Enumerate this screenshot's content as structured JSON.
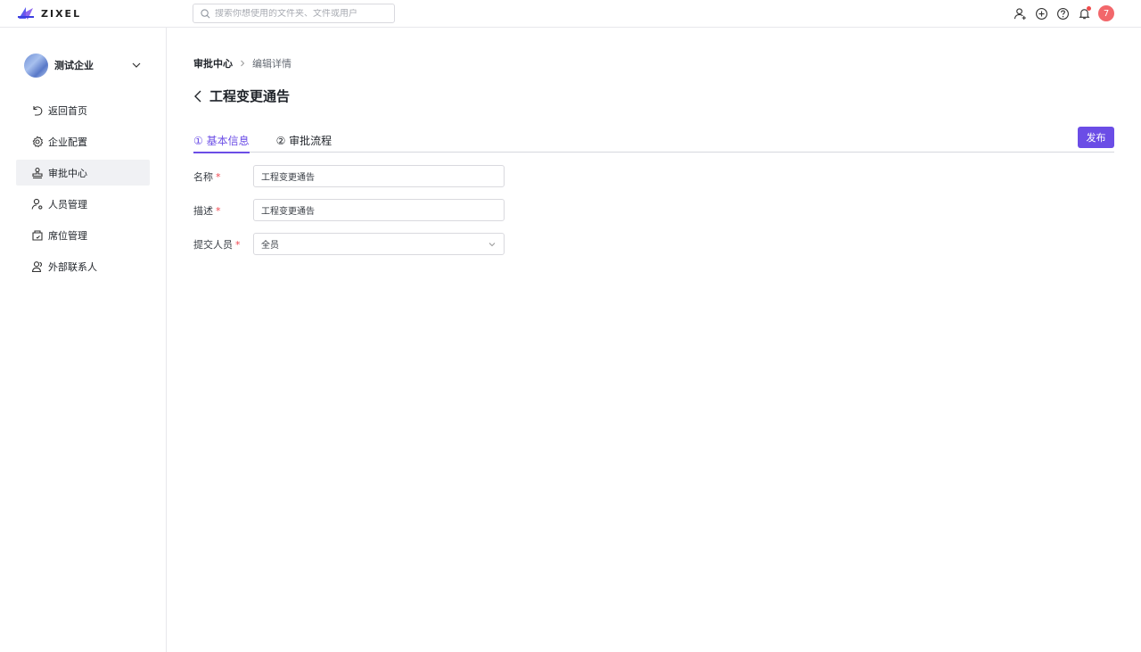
{
  "app": {
    "logo_text": "ZIXEL",
    "search_placeholder": "搜索你想使用的文件夹、文件或用户",
    "user_avatar_text": "7"
  },
  "sidebar": {
    "org_name": "测试企业",
    "items": [
      {
        "label": "返回首页",
        "icon": "return-icon"
      },
      {
        "label": "企业配置",
        "icon": "gear-icon"
      },
      {
        "label": "审批中心",
        "icon": "stamp-icon",
        "active": true
      },
      {
        "label": "人员管理",
        "icon": "user-settings-icon"
      },
      {
        "label": "席位管理",
        "icon": "seat-icon"
      },
      {
        "label": "外部联系人",
        "icon": "contacts-icon"
      }
    ]
  },
  "main": {
    "breadcrumb": {
      "root": "审批中心",
      "current": "编辑详情"
    },
    "title": "工程变更通告",
    "tabs": [
      {
        "label": "① 基本信息",
        "active": true
      },
      {
        "label": "② 审批流程",
        "active": false
      }
    ],
    "publish_label": "发布",
    "form": {
      "name_label": "名称",
      "name_value": "工程变更通告",
      "desc_label": "描述",
      "desc_value": "工程变更通告",
      "submitter_label": "提交人员",
      "submitter_value": "全员",
      "required_mark": "*"
    }
  },
  "colors": {
    "accent": "#6b4de6",
    "required": "#f0464f",
    "avatar": "#f2676b"
  }
}
